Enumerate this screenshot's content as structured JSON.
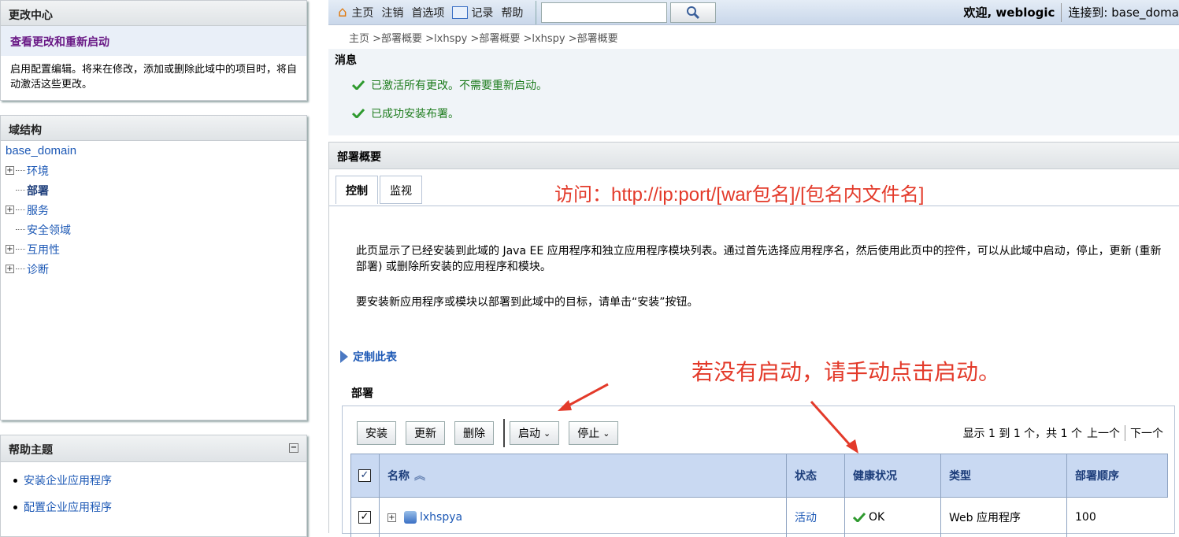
{
  "change_center": {
    "title": "更改中心",
    "link": "查看更改和重新启动",
    "text": "启用配置编辑。将来在修改，添加或删除此域中的项目时，将自动激活这些更改。"
  },
  "domain_structure": {
    "title": "域结构",
    "root": "base_domain",
    "items": [
      "环境",
      "部署",
      "服务",
      "安全领域",
      "互用性",
      "诊断"
    ]
  },
  "help": {
    "title": "帮助主题",
    "items": [
      "安装企业应用程序",
      "配置企业应用程序"
    ]
  },
  "topbar": {
    "home": "主页",
    "logout": "注销",
    "prefs": "首选项",
    "record": "记录",
    "help": "帮助",
    "welcome": "欢迎, weblogic",
    "connected": "连接到: base_doma"
  },
  "breadcrumb": "主页 >部署概要 >lxhspy >部署概要 >lxhspy >部署概要",
  "messages": {
    "title": "消息",
    "items": [
      "已激活所有更改。不需要重新启动。",
      "已成功安装布署。"
    ]
  },
  "summary": {
    "title": "部署概要",
    "tabs": [
      "控制",
      "监视"
    ],
    "desc1": "此页显示了已经安装到此域的 Java EE 应用程序和独立应用程序模块列表。通过首先选择应用程序名，然后使用此页中的控件，可以从此域中启动，停止，更新 (重新部署) 或删除所安装的应用程序和模块。",
    "desc2": "要安装新应用程序或模块以部署到此域中的目标，请单击“安装”按钮。",
    "customize": "定制此表",
    "deploy_label": "部署"
  },
  "annotations": {
    "access": "访问：http://ip:port/[war包名]/[包名内文件名]",
    "start_hint": "若没有启动，请手动点击启动。"
  },
  "buttons": {
    "install": "安装",
    "update": "更新",
    "delete": "删除",
    "start": "启动",
    "stop": "停止"
  },
  "pager": {
    "info": "显示 1 到 1 个，共 1 个",
    "prev": "上一个",
    "next": "下一个"
  },
  "table": {
    "headers": [
      "名称",
      "状态",
      "健康状况",
      "类型",
      "部署顺序"
    ],
    "rows": [
      {
        "name": "lxhspya",
        "state": "活动",
        "health": "OK",
        "type": "Web 应用程序",
        "order": "100"
      }
    ]
  }
}
